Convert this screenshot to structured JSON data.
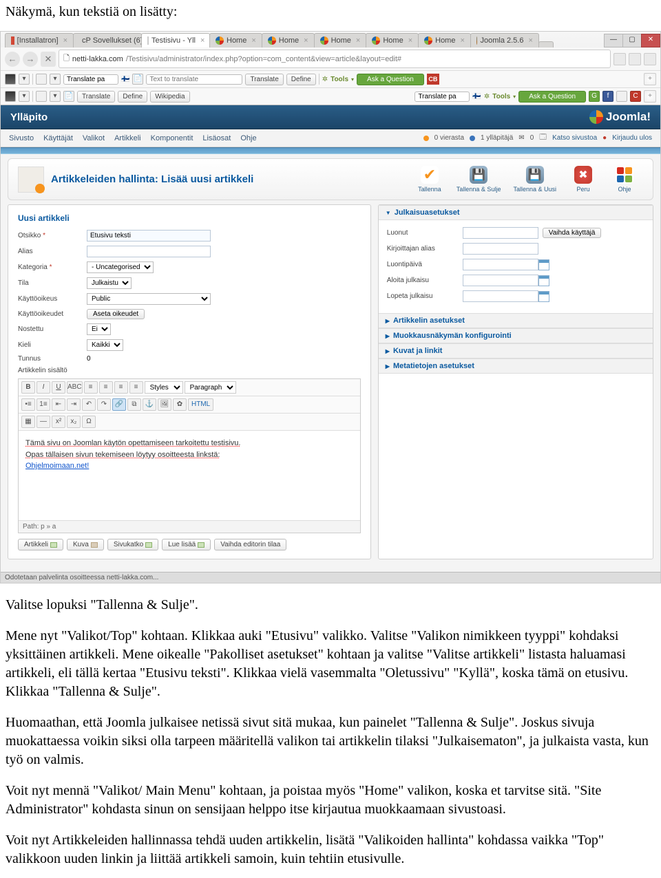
{
  "doc": {
    "intro": "Näkymä, kun tekstiä on lisätty:",
    "p1": "Valitse lopuksi \"Tallenna & Sulje\".",
    "p2": "Mene nyt \"Valikot/Top\" kohtaan. Klikkaa auki \"Etusivu\" valikko. Valitse \"Valikon nimikkeen tyyppi\" kohdaksi yksittäinen artikkeli. Mene oikealle \"Pakolliset asetukset\" kohtaan ja valitse \"Valitse artikkeli\" listasta haluamasi artikkeli, eli tällä kertaa \"Etusivu teksti\". Klikkaa vielä vasemmalta \"Oletussivu\" \"Kyllä\", koska tämä on etusivu. Klikkaa \"Tallenna & Sulje\".",
    "p3": "Huomaathan, että Joomla julkaisee netissä sivut sitä mukaa, kun painelet \"Tallenna & Sulje\". Joskus sivuja muokattaessa voikin siksi olla tarpeen määritellä valikon tai artikkelin tilaksi \"Julkaisematon\", ja julkaista vasta, kun työ on valmis.",
    "p4": "Voit nyt mennä \"Valikot/ Main Menu\" kohtaan, ja poistaa myös \"Home\" valikon, koska et tarvitse sitä. \"Site Administrator\" kohdasta sinun on sensijaan helppo itse kirjautua muokkaamaan sivustoasi.",
    "p5": "Voit nyt Artikkeleiden hallinnassa tehdä uuden artikkelin, lisätä \"Valikoiden hallinta\" kohdassa vaikka \"Top\" valikkoon uuden linkin ja liittää artikkeli samoin, kuin tehtiin etusivulle."
  },
  "browser": {
    "tabs": [
      "[Installatron]",
      "cP Sovellukset (6)",
      "Testisivu - Yll",
      "Home",
      "Home",
      "Home",
      "Home",
      "Home",
      "Joomla 2.5.6"
    ],
    "active_tab_index": 2,
    "url_host": "netti-lakka.com",
    "url_path": "/Testisivu/administrator/index.php?option=com_content&view=article&layout=edit#",
    "tb1": {
      "translate": "Translate pa",
      "text": "Text to translate",
      "btn_tr": "Translate",
      "btn_def": "Define",
      "tools": "Tools",
      "ask": "Ask a Question"
    },
    "tb2": {
      "btn_tr": "Translate",
      "btn_def": "Define",
      "btn_wik": "Wikipedia",
      "translate": "Translate pa",
      "tools": "Tools",
      "ask": "Ask a Question"
    }
  },
  "joomla": {
    "admin_title": "Ylläpito",
    "logo": "Joomla!",
    "menu": [
      "Sivusto",
      "Käyttäjät",
      "Valikot",
      "Artikkeli",
      "Komponentit",
      "Lisäosat",
      "Ohje"
    ],
    "status": {
      "vierasta": "0 vierasta",
      "yllapitaja": "1 ylläpitäjä",
      "msg": "0",
      "katso": "Katso sivustoa",
      "kirjaudu": "Kirjaudu ulos"
    },
    "page_title": "Artikkeleiden hallinta: Lisää uusi artikkeli",
    "actions": {
      "tallenna": "Tallenna",
      "tallenna_sulje": "Tallenna & Sulje",
      "tallenna_uusi": "Tallenna & Uusi",
      "peru": "Peru",
      "ohje": "Ohje"
    }
  },
  "form": {
    "section_title": "Uusi artikkeli",
    "labels": {
      "otsikko": "Otsikko",
      "alias": "Alias",
      "kategoria": "Kategoria",
      "tila": "Tila",
      "kaytto": "Käyttöoikeus",
      "kayttod": "Käyttöoikeudet",
      "nostettu": "Nostettu",
      "kieli": "Kieli",
      "tunnus": "Tunnus",
      "sisalto": "Artikkelin sisältö"
    },
    "values": {
      "otsikko": "Etusivu teksti",
      "kategoria": "- Uncategorised",
      "tila": "Julkaistu",
      "kaytto": "Public",
      "kayttod": "Aseta oikeudet",
      "nostettu": "Ei",
      "kieli": "Kaikki",
      "tunnus": "0"
    },
    "below": {
      "artikkeli": "Artikkeli",
      "kuva": "Kuva",
      "sivukatko": "Sivukatko",
      "luelisaa": "Lue lisää",
      "vaihda": "Vaihda editorin tilaa"
    }
  },
  "editor": {
    "styles": "Styles",
    "paragraph": "Paragraph",
    "line1": "Tämä sivu on Joomlan käytön opettamiseen tarkoitettu testisivu.",
    "line2": "Opas tällaisen sivun tekemiseen löytyy osoitteesta linkstä:",
    "link": "Ohjelmoimaan.net!",
    "path": "Path: p » a"
  },
  "right": {
    "pub_title": "Julkaisuasetukset",
    "labels": {
      "luonut": "Luonut",
      "kirjoittajan": "Kirjoittajan alias",
      "luontipaiva": "Luontipäivä",
      "aloita": "Aloita julkaisu",
      "lopeta": "Lopeta julkaisu"
    },
    "vaihda": "Vaihda käyttäjä",
    "acc": [
      "Artikkelin asetukset",
      "Muokkausnäkymän konfigurointi",
      "Kuvat ja linkit",
      "Metatietojen asetukset"
    ]
  },
  "statusbar": "Odotetaan palvelinta osoitteessa netti-lakka.com..."
}
